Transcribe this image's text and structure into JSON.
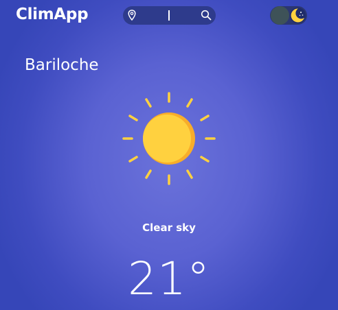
{
  "app": {
    "title": "ClimApp"
  },
  "search": {
    "value": "",
    "placeholder": ""
  },
  "location": {
    "city": "Bariloche"
  },
  "weather": {
    "icon": "sun-icon",
    "description": "Clear sky",
    "temperature": "21°"
  },
  "theme_toggle": {
    "icon": "moon-icon",
    "state": "dark"
  },
  "colors": {
    "background": "#5a62d2",
    "search_bg": "#2e3b8c",
    "sun": "#ffd13f",
    "sun_shade": "#f8ad2a"
  }
}
